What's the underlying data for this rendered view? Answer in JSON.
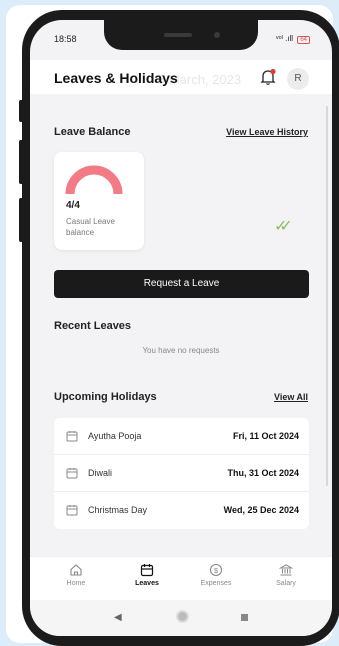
{
  "status": {
    "time": "18:58",
    "icons": "◌ ✉",
    "signal": "ᵛᵒˡ .ıll",
    "battery": "64"
  },
  "header": {
    "title": "Leaves & Holidays",
    "ghost_text": "8 March, 2023",
    "avatar_letter": "R"
  },
  "leave_balance": {
    "title": "Leave Balance",
    "history_link": "View Leave History",
    "count": "4/4",
    "description": "Casual Leave balance",
    "gauge_fraction": 1.0,
    "gauge_color": "#f27b86",
    "check_color": "#8fbf5a"
  },
  "request_button": "Request a Leave",
  "recent": {
    "title": "Recent Leaves",
    "empty": "You have no requests"
  },
  "holidays": {
    "title": "Upcoming Holidays",
    "view_all": "View All",
    "items": [
      {
        "name": "Ayutha Pooja",
        "date": "Fri, 11 Oct 2024"
      },
      {
        "name": "Diwali",
        "date": "Thu, 31 Oct 2024"
      },
      {
        "name": "Christmas Day",
        "date": "Wed, 25 Dec 2024"
      }
    ]
  },
  "tabs": [
    {
      "label": "Home",
      "icon": "home-icon"
    },
    {
      "label": "Leaves",
      "icon": "calendar-icon",
      "active": true
    },
    {
      "label": "Expenses",
      "icon": "dollar-icon"
    },
    {
      "label": "Salary",
      "icon": "bank-icon"
    }
  ],
  "navbar": {
    "back": "◀",
    "home": "●",
    "recent": "■"
  }
}
